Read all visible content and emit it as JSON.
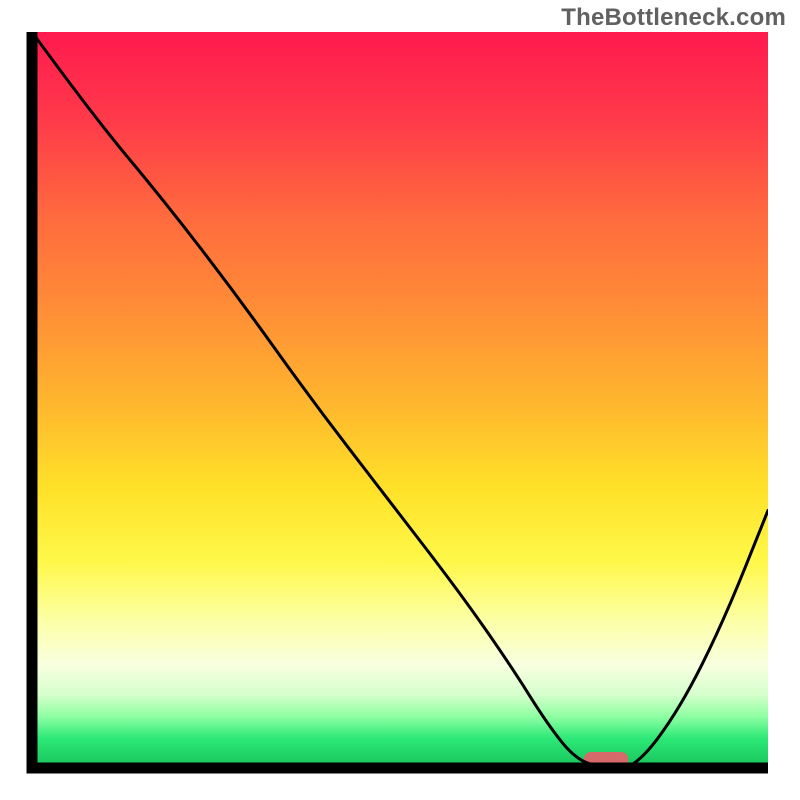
{
  "watermark": "TheBottleneck.com",
  "chart_data": {
    "type": "line",
    "title": "",
    "xlabel": "",
    "ylabel": "",
    "xlim": [
      0,
      100
    ],
    "ylim": [
      0,
      100
    ],
    "grid": false,
    "legend": false,
    "annotations": [],
    "background_gradient_rows": [
      {
        "y": 0,
        "color": "#ff1a4e"
      },
      {
        "y": 12,
        "color": "#ff3a4a"
      },
      {
        "y": 25,
        "color": "#ff6a3e"
      },
      {
        "y": 38,
        "color": "#ff8e36"
      },
      {
        "y": 50,
        "color": "#ffb52e"
      },
      {
        "y": 62,
        "color": "#ffe128"
      },
      {
        "y": 72,
        "color": "#fff84a"
      },
      {
        "y": 80,
        "color": "#fcffa6"
      },
      {
        "y": 86,
        "color": "#f8ffe0"
      },
      {
        "y": 90,
        "color": "#d6ffcc"
      },
      {
        "y": 93,
        "color": "#8effa2"
      },
      {
        "y": 96,
        "color": "#2ce876"
      },
      {
        "y": 100,
        "color": "#18c35a"
      }
    ],
    "series": [
      {
        "name": "bottleneck-curve",
        "color": "#000000",
        "x": [
          0,
          8,
          18,
          28,
          38,
          48,
          58,
          65,
          70,
          74,
          78,
          82,
          88,
          94,
          100
        ],
        "y": [
          100,
          89,
          77,
          64,
          50,
          37,
          24,
          14,
          6,
          1,
          0,
          0,
          8,
          20,
          35
        ]
      }
    ],
    "marker": {
      "name": "optimal-marker",
      "x_center": 78,
      "width": 6,
      "color": "#d66a6a"
    }
  },
  "colors": {
    "axis": "#000000",
    "marker": "#d66a6a"
  }
}
